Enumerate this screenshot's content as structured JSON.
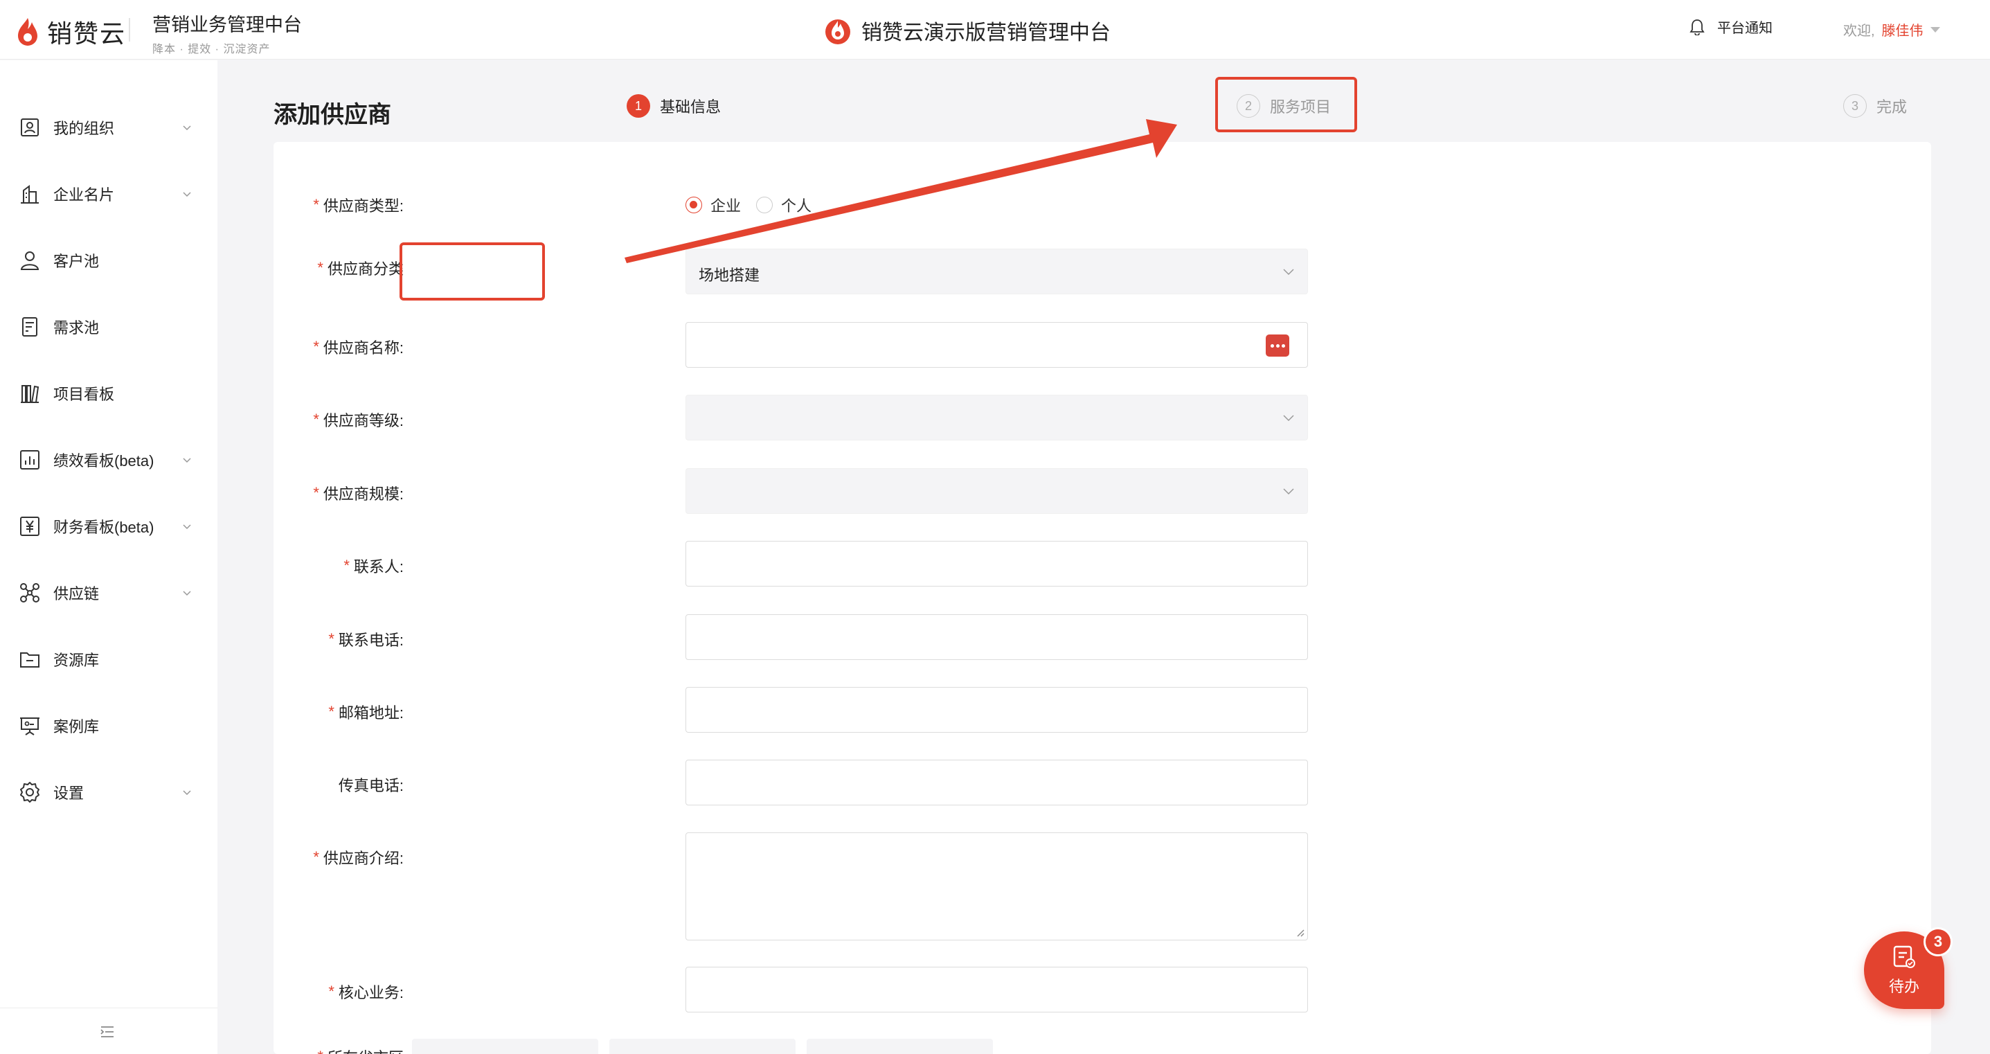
{
  "header": {
    "logo_text": "销赞云",
    "subbrand_title": "营销业务管理中台",
    "subbrand_tags": "降本 · 提效 · 沉淀资产",
    "center_title": "销赞云演示版营销管理中台",
    "notify_label": "平台通知",
    "welcome_label": "欢迎,",
    "username": "滕佳伟"
  },
  "sidebar": {
    "items": [
      {
        "label": "我的组织",
        "icon": "org-icon",
        "has_chevron": true
      },
      {
        "label": "企业名片",
        "icon": "building-icon",
        "has_chevron": true
      },
      {
        "label": "客户池",
        "icon": "user-icon",
        "has_chevron": false
      },
      {
        "label": "需求池",
        "icon": "document-icon",
        "has_chevron": false
      },
      {
        "label": "项目看板",
        "icon": "books-icon",
        "has_chevron": false
      },
      {
        "label": "绩效看板(beta)",
        "icon": "bar-chart-icon",
        "has_chevron": true
      },
      {
        "label": "财务看板(beta)",
        "icon": "yen-icon",
        "has_chevron": true
      },
      {
        "label": "供应链",
        "icon": "network-icon",
        "has_chevron": true
      },
      {
        "label": "资源库",
        "icon": "folder-icon",
        "has_chevron": false
      },
      {
        "label": "案例库",
        "icon": "presentation-icon",
        "has_chevron": false
      },
      {
        "label": "设置",
        "icon": "gear-icon",
        "has_chevron": true
      }
    ]
  },
  "page": {
    "title": "添加供应商"
  },
  "steps": [
    {
      "num": "1",
      "label": "基础信息",
      "active": true
    },
    {
      "num": "2",
      "label": "服务项目",
      "active": false
    },
    {
      "num": "3",
      "label": "完成",
      "active": false
    }
  ],
  "form": {
    "type_label": "供应商类型:",
    "type_options": [
      "企业",
      "个人"
    ],
    "type_selected": "企业",
    "category_label": "供应商分类",
    "category_value": "场地搭建",
    "name_label": "供应商名称:",
    "level_label": "供应商等级:",
    "scale_label": "供应商规模:",
    "contact_label": "联系人:",
    "phone_label": "联系电话:",
    "email_label": "邮箱地址:",
    "fax_label": "传真电话:",
    "intro_label": "供应商介绍:",
    "core_label": "核心业务:",
    "region_label": "所在省市区"
  },
  "todo": {
    "label": "待办",
    "count": "3"
  },
  "colors": {
    "accent": "#e3432f",
    "background": "#f4f4f6"
  }
}
